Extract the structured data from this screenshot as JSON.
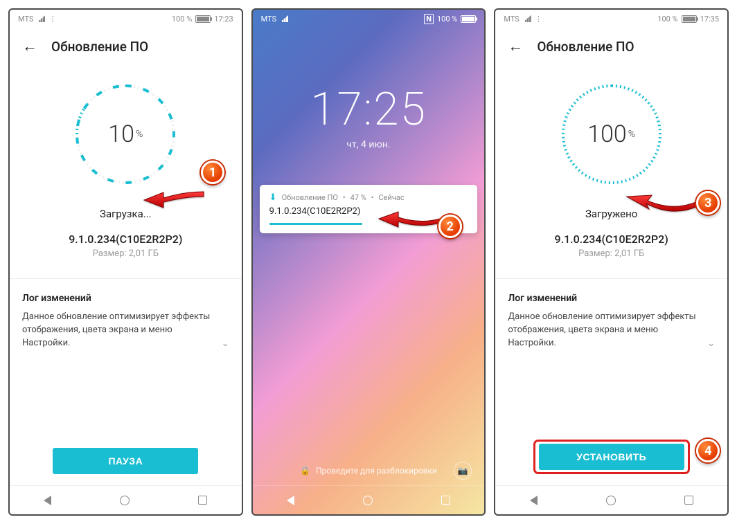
{
  "statusbar": {
    "carrier": "MTS",
    "battery_pct": "100 %",
    "time1": "17:23",
    "time3": "17:35",
    "lock_battery": "100 %",
    "nfc": "N"
  },
  "update": {
    "title": "Обновление ПО",
    "version": "9.1.0.234(C10E2R2P2)",
    "size": "Размер: 2,01 ГБ",
    "progress1": "10",
    "progress3": "100",
    "pct_symbol": "%",
    "status_loading": "Загрузка...",
    "status_done": "Загружено",
    "changelog_title": "Лог изменений",
    "changelog_text": "Данное обновление оптимизирует эффекты отображения, цвета экрана и меню Настройки.",
    "btn_pause": "ПАУЗА",
    "btn_install": "УСТАНОВИТЬ"
  },
  "lockscreen": {
    "time": "17:25",
    "date": "чт, 4 июн.",
    "notif_app": "Обновление ПО",
    "notif_pct": "47 %",
    "notif_when": "Сейчас",
    "notif_body": "9.1.0.234(C10E2R2P2)",
    "unlock_hint": "Проведите для разблокировки"
  },
  "badges": {
    "b1": "1",
    "b2": "2",
    "b3": "3",
    "b4": "4"
  }
}
